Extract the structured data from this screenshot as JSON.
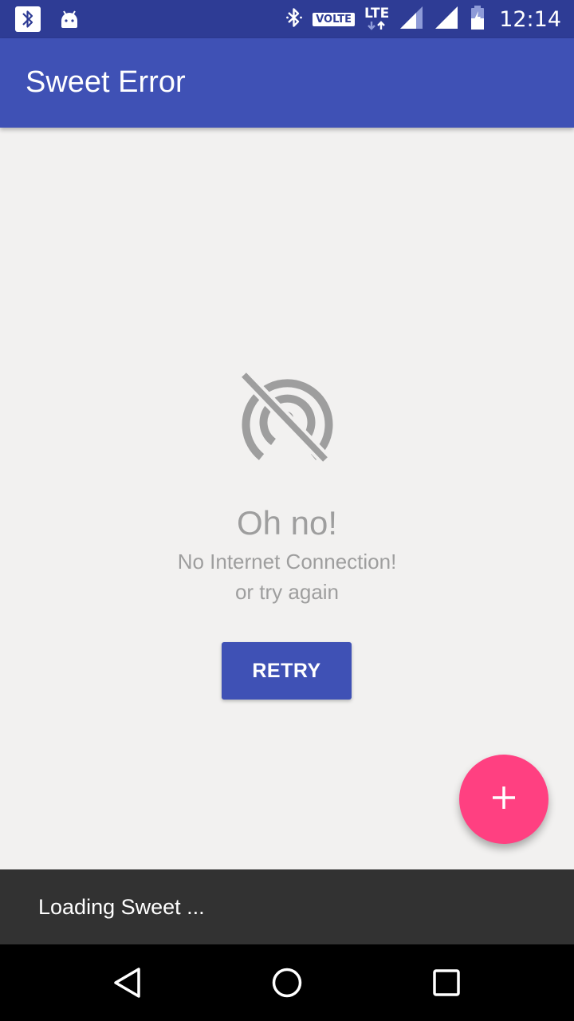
{
  "status_bar": {
    "time": "12:14",
    "volte_label": "VOLTE",
    "network_label": "LTE",
    "icons": [
      "bluetooth-notification-icon",
      "android-icon",
      "bluetooth-icon",
      "volte-icon",
      "lte-icon",
      "signal-icon",
      "signal-icon-2",
      "battery-icon"
    ]
  },
  "app_bar": {
    "title": "Sweet Error",
    "color": "#3f51b5"
  },
  "error_state": {
    "icon": "no-signal-icon",
    "title": "Oh no!",
    "message": "No Internet Connection!",
    "hint": "or try again",
    "retry_label": "RETRY",
    "text_color": "#9e9e9e"
  },
  "fab": {
    "icon": "plus-icon",
    "color": "#ff4081"
  },
  "snackbar": {
    "text": "Loading Sweet ..."
  },
  "nav_bar": {
    "buttons": [
      "back-icon",
      "home-icon",
      "recents-icon"
    ]
  }
}
